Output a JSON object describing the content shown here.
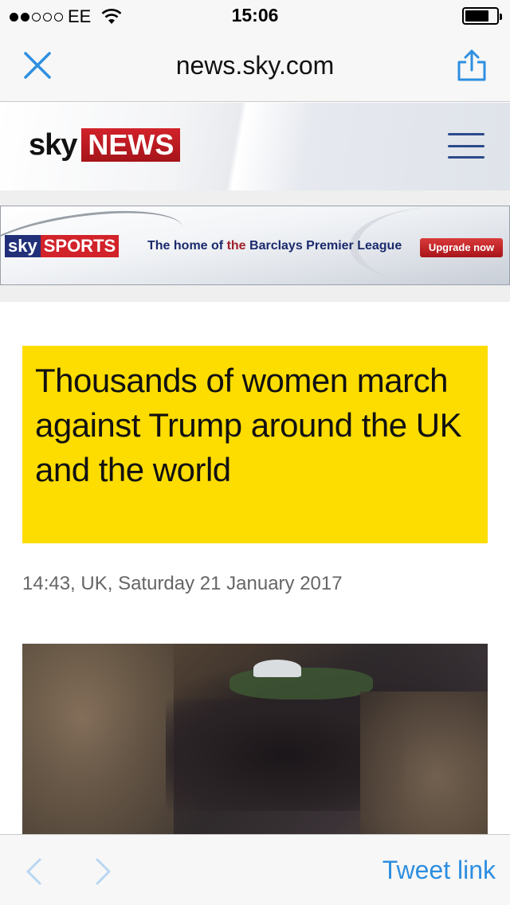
{
  "status_bar": {
    "carrier": "EE",
    "time": "15:06",
    "signal_strength": 2,
    "signal_max": 5
  },
  "browser": {
    "url": "news.sky.com",
    "close_icon": "close-icon",
    "share_icon": "share-icon"
  },
  "header": {
    "logo_sky": "sky",
    "logo_news": "NEWS",
    "menu_icon": "hamburger-menu-icon"
  },
  "ad": {
    "logo_sky": "sky",
    "logo_sports": "SPORTS",
    "text_prefix": "The home of ",
    "text_the": "the",
    "text_suffix": " Barclays Premier League",
    "button": "Upgrade now"
  },
  "article": {
    "headline": "Thousands of women march against Trump around the UK and the world",
    "timestamp": "14:43, UK, Saturday 21 January 2017"
  },
  "toolbar": {
    "back_icon": "chevron-left-icon",
    "forward_icon": "chevron-right-icon",
    "tweet_link": "Tweet link"
  },
  "colors": {
    "headline_bg": "#fddc00",
    "link_blue": "#2e8fe0",
    "sky_red": "#d2222a"
  }
}
